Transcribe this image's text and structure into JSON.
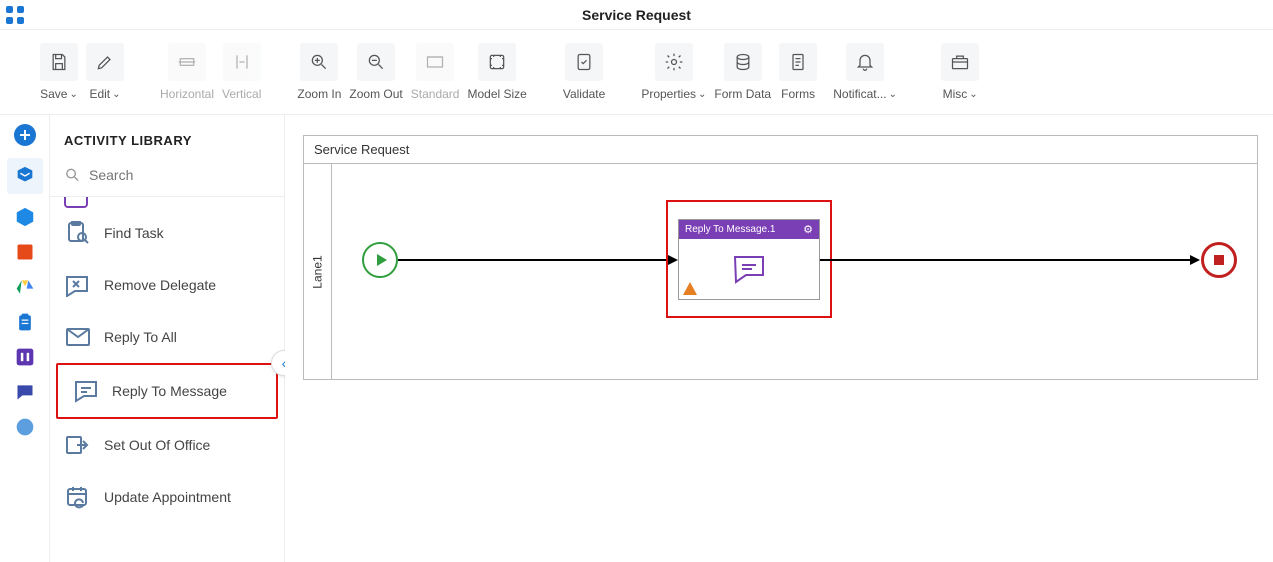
{
  "header": {
    "title": "Service Request"
  },
  "toolbar": {
    "save": "Save",
    "edit": "Edit",
    "horizontal": "Horizontal",
    "vertical": "Vertical",
    "zoom_in": "Zoom In",
    "zoom_out": "Zoom Out",
    "standard": "Standard",
    "model_size": "Model Size",
    "validate": "Validate",
    "properties": "Properties",
    "form_data": "Form Data",
    "forms": "Forms",
    "notifications": "Notificat...",
    "misc": "Misc"
  },
  "sidebar": {
    "title": "ACTIVITY LIBRARY",
    "search_placeholder": "Search",
    "items": [
      {
        "label": "Find Task"
      },
      {
        "label": "Remove Delegate"
      },
      {
        "label": "Reply To All"
      },
      {
        "label": "Reply To Message"
      },
      {
        "label": "Set Out Of Office"
      },
      {
        "label": "Update Appointment"
      }
    ]
  },
  "canvas": {
    "process_name": "Service Request",
    "lane_name": "Lane1",
    "task_title": "Reply To Message.1"
  }
}
